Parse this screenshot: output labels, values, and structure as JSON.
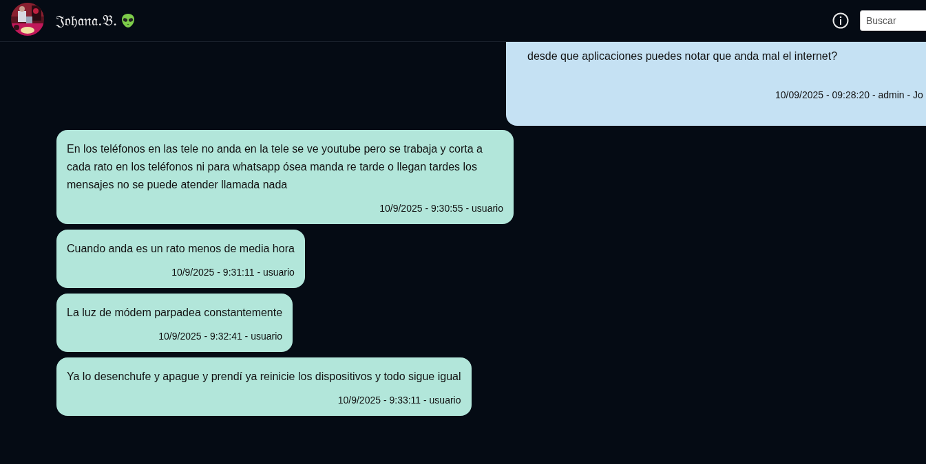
{
  "header": {
    "contact_name": "𝔍𝔬𝔥𝔞𝔫𝔞.𝔅.",
    "search": {
      "placeholder": "Buscar"
    }
  },
  "messages": [
    {
      "kind": "outgoing",
      "text": "desde que aplicaciones puedes notar que anda mal el internet?",
      "meta": "10/09/2025 - 09:28:20 - admin - Jo"
    },
    {
      "kind": "incoming",
      "text": "En los teléfonos en las tele no anda en la tele se ve youtube pero se trabaja y corta a cada rato en los teléfonos ni para whatsapp ósea manda re tarde o llegan tardes los mensajes no se puede atender llamada nada",
      "meta": "10/9/2025 - 9:30:55 - usuario"
    },
    {
      "kind": "incoming",
      "text": "Cuando anda es un rato menos de media hora",
      "meta": "10/9/2025 - 9:31:11 - usuario"
    },
    {
      "kind": "incoming",
      "text": "La luz de módem parpadea constantemente",
      "meta": "10/9/2025 - 9:32:41 - usuario"
    },
    {
      "kind": "incoming",
      "text": "Ya lo desenchufe y apague y prendí ya reinicie los dispositivos y todo sigue igual",
      "meta": "10/9/2025 - 9:33:11 - usuario"
    }
  ]
}
